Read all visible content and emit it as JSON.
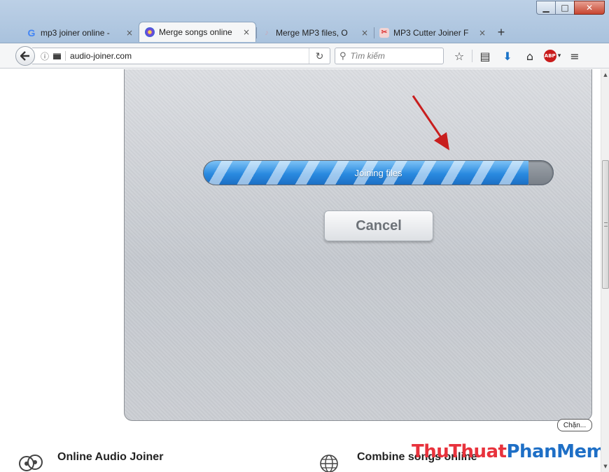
{
  "window": {
    "controls": {
      "minimize": "▁",
      "maximize": "□",
      "close": "✕"
    }
  },
  "tabs": [
    {
      "label": "mp3 joiner online - ",
      "icon": "google-icon",
      "active": false
    },
    {
      "label": "Merge songs online",
      "icon": "merge-songs-icon",
      "active": true
    },
    {
      "label": "Merge MP3 files, O",
      "icon": "audio-icon",
      "active": false
    },
    {
      "label": "MP3 Cutter Joiner F",
      "icon": "mp3-cutter-icon",
      "active": false
    }
  ],
  "tab_close_glyph": "×",
  "new_tab_glyph": "+",
  "navbar": {
    "url": "audio-joiner.com",
    "search_placeholder": "Tìm kiếm"
  },
  "progress": {
    "label": "Joining files",
    "fraction": 0.93,
    "colors": {
      "fill": "#2a8ae0",
      "track": "#787f88"
    }
  },
  "cancel_label": "Cancel",
  "block_label": "Chặn...",
  "features": [
    {
      "title": "Online Audio Joiner",
      "icon": "vinyl-records-icon"
    },
    {
      "title": "Combine songs online",
      "icon": "globe-icon"
    }
  ],
  "watermark": {
    "part1": "ThuThuat",
    "part2": "PhanMem.vn"
  },
  "accent_colors": {
    "arrow": "#c81e1e",
    "watermark_red": "#e8323c",
    "watermark_blue": "#1e6fc6"
  }
}
